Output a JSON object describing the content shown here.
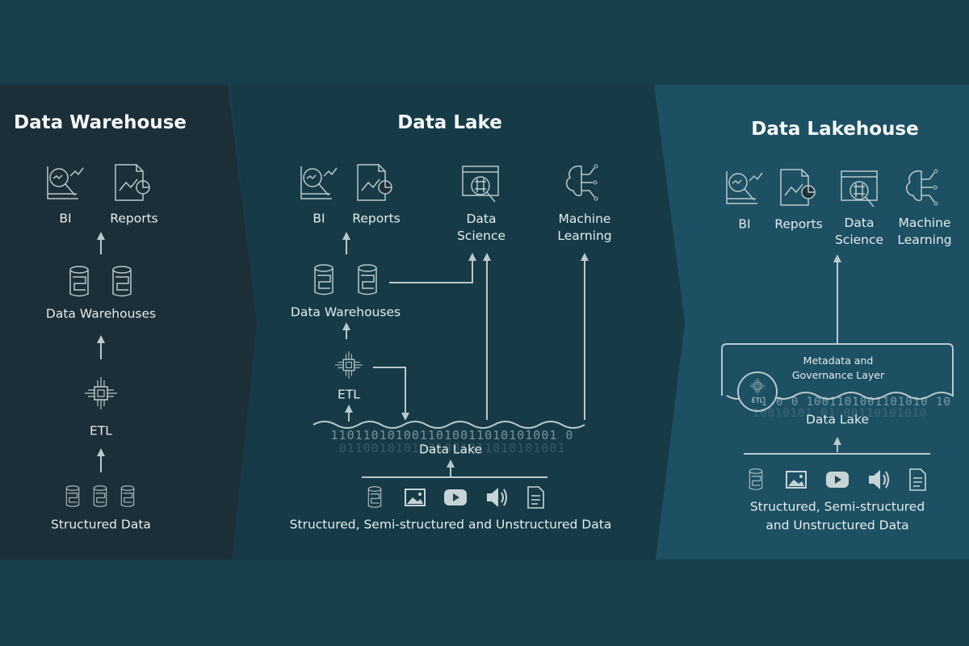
{
  "panels": {
    "warehouse": {
      "title": "Data Warehouse",
      "bi": "BI",
      "reports": "Reports",
      "data_warehouses": "Data Warehouses",
      "etl": "ETL",
      "source": "Structured Data"
    },
    "lake": {
      "title": "Data Lake",
      "bi": "BI",
      "reports": "Reports",
      "data_science": "Data Science",
      "machine_learning": "Machine Learning",
      "data_warehouses": "Data Warehouses",
      "etl": "ETL",
      "data_lake": "Data Lake",
      "binary_top": "1101101010011010011010101001 0",
      "binary_bottom": "0110010101101001011010101001",
      "source": "Structured, Semi-structured and Unstructured Data"
    },
    "lakehouse": {
      "title": "Data Lakehouse",
      "bi": "BI",
      "reports": "Reports",
      "data_science": "Data Science",
      "machine_learning": "Machine Learning",
      "metadata_layer": "Metadata and Governance Layer",
      "etl": "ETL",
      "data_lake": "Data Lake",
      "binary_top": "1 0  0 1001101001101010 10",
      "binary_bottom": "10010101 01 00110101010",
      "source_line1": "Structured, Semi-structured",
      "source_line2": "and Unstructured Data"
    }
  },
  "colors": {
    "background": "#173e4b",
    "warehouse_panel": "#1c2e38",
    "lake_panel": "#163b47",
    "lakehouse_panel": "#1d5062",
    "line": "#b9c9cd"
  }
}
